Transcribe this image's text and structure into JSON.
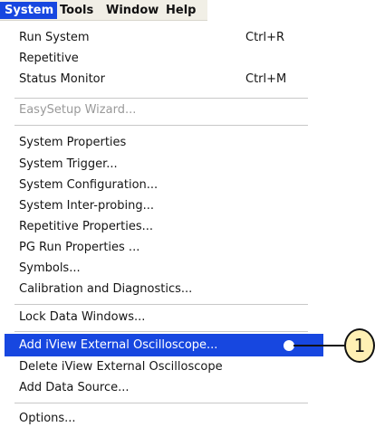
{
  "menubar": {
    "items": [
      {
        "label": "System"
      },
      {
        "label": "Tools"
      },
      {
        "label": "Window"
      },
      {
        "label": "Help"
      }
    ]
  },
  "menu": {
    "items": [
      {
        "label": "Run System",
        "shortcut": "Ctrl+R"
      },
      {
        "label": "Repetitive"
      },
      {
        "label": "Status Monitor",
        "shortcut": "Ctrl+M"
      },
      {
        "label": "EasySetup Wizard...",
        "disabled": true
      },
      {
        "label": "System Properties"
      },
      {
        "label": "System Trigger..."
      },
      {
        "label": "System Configuration..."
      },
      {
        "label": "System Inter-probing..."
      },
      {
        "label": "Repetitive Properties..."
      },
      {
        "label": "PG Run Properties ..."
      },
      {
        "label": "Symbols..."
      },
      {
        "label": "Calibration and Diagnostics..."
      },
      {
        "label": "Lock Data Windows..."
      },
      {
        "label": "Add iView External Oscilloscope...",
        "highlighted": true
      },
      {
        "label": "Delete iView External Oscilloscope"
      },
      {
        "label": "Add Data Source..."
      },
      {
        "label": "Options..."
      }
    ]
  },
  "callout": {
    "number": "1"
  },
  "colors": {
    "highlight": "#1747e0",
    "callout_fill": "#fff0b4"
  }
}
